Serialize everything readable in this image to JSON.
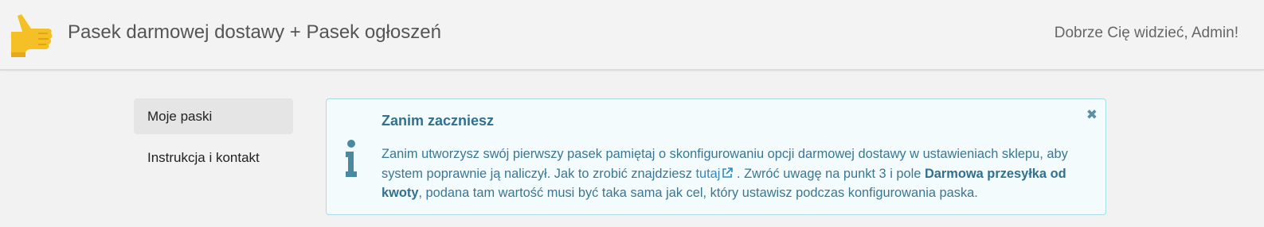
{
  "header": {
    "app_title": "Pasek darmowej dostawy + Pasek ogłoszeń",
    "welcome_text": "Dobrze Cię widzieć, Admin!"
  },
  "sidebar": {
    "items": [
      {
        "label": "Moje paski",
        "active": true
      },
      {
        "label": "Instrukcja i kontakt",
        "active": false
      }
    ]
  },
  "alert": {
    "title": "Zanim zaczniesz",
    "close_symbol": "✖",
    "text_part1": "Zanim utworzysz swój pierwszy pasek pamiętaj o skonfigurowaniu opcji darmowej dostawy w ustawieniach sklepu, aby system poprawnie ją naliczył. Jak to zrobić znajdziesz ",
    "link_text": "tutaj",
    "text_part2": " . Zwróć uwagę na punkt 3 i pole ",
    "bold_text": "Darmowa przesyłka od kwoty",
    "text_part3": ", podana tam wartość musi być taka sama jak cel, który ustawisz podczas konfigurowania paska."
  },
  "colors": {
    "logo_yellow": "#f5c026",
    "alert_text": "#31708f",
    "alert_border": "#a9dbe6",
    "link": "#2e8bc0"
  },
  "icons": {
    "logo": "pointing-hand-logo-icon",
    "info": "info-icon",
    "close": "close-icon",
    "external_link": "external-link-icon"
  }
}
